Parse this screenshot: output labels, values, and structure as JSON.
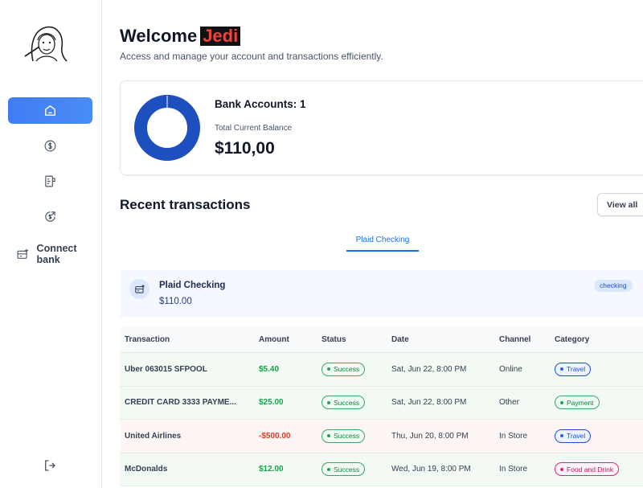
{
  "header": {
    "welcome": "Welcome",
    "user_name": "Jedi",
    "subtitle": "Access and manage your account and transactions efficiently."
  },
  "sidebar": {
    "items": [
      {
        "icon": "home-icon",
        "active": true
      },
      {
        "icon": "dollar-icon",
        "active": false
      },
      {
        "icon": "receipt-icon",
        "active": false
      },
      {
        "icon": "money-send-icon",
        "active": false
      }
    ],
    "connect_bank_label": "Connect bank",
    "logout_icon": "logout-icon"
  },
  "balance": {
    "bank_accounts_label": "Bank Accounts: 1",
    "total_label": "Total Current Balance",
    "total_value": "$110,00",
    "donut_color": "#1e4fbf"
  },
  "recent": {
    "title": "Recent transactions",
    "view_all": "View all",
    "tabs": [
      "Plaid Checking"
    ],
    "account": {
      "name": "Plaid Checking",
      "balance": "$110.00",
      "type": "checking"
    },
    "columns": [
      "Transaction",
      "Amount",
      "Status",
      "Date",
      "Channel",
      "Category"
    ],
    "rows": [
      {
        "name": "Uber 063015 SFPOOL",
        "amount": "$5.40",
        "kind": "pos",
        "status": "Success",
        "date": "Sat, Jun 22, 8:00 PM",
        "channel": "Online",
        "category": "Travel",
        "cat_style": "travel"
      },
      {
        "name": "CREDIT CARD 3333 PAYME...",
        "amount": "$25.00",
        "kind": "pos",
        "status": "Success",
        "date": "Sat, Jun 22, 8:00 PM",
        "channel": "Other",
        "category": "Payment",
        "cat_style": "payment"
      },
      {
        "name": "United Airlines",
        "amount": "-$500.00",
        "kind": "neg",
        "status": "Success",
        "date": "Thu, Jun 20, 8:00 PM",
        "channel": "In Store",
        "category": "Travel",
        "cat_style": "travel"
      },
      {
        "name": "McDonalds",
        "amount": "$12.00",
        "kind": "pos",
        "status": "Success",
        "date": "Wed, Jun 19, 8:00 PM",
        "channel": "In Store",
        "category": "Food and Drink",
        "cat_style": "food"
      }
    ]
  }
}
